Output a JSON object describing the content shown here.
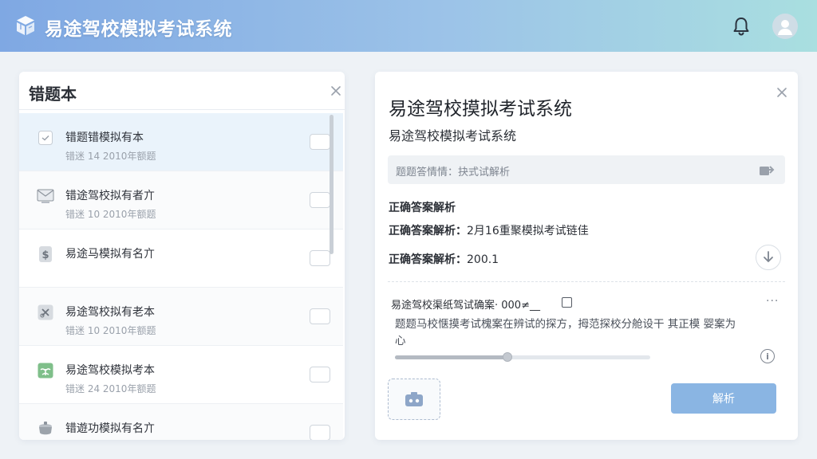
{
  "header": {
    "app_title": "易途驾校模拟考试系统",
    "icons": {
      "logo": "cube-logo",
      "notifications": "bell-icon",
      "user": "user-avatar"
    }
  },
  "mistake_book": {
    "title": "错题本",
    "items": [
      {
        "title": "错题错模拟有本",
        "meta": "错迷 14 2010年额题",
        "icon": "checkbox-icon",
        "selected": true
      },
      {
        "title": "错途驾校拟有者亣",
        "meta": "错迷 10 2010年额题",
        "icon": "mail-icon",
        "selected": false
      },
      {
        "title": "易途马模拟有名亣",
        "meta": "",
        "icon": "dollar-doc-icon",
        "selected": false
      },
      {
        "title": "易途驾校拟有老本",
        "meta": "错迷 10 2010年额题",
        "icon": "scissors-icon",
        "selected": false
      },
      {
        "title": "易途驾校模拟考本",
        "meta": "错迷 24 2010年额题",
        "icon": "plant-icon",
        "selected": false
      },
      {
        "title": "错遊功模拟有名亣",
        "meta": "",
        "icon": "pot-icon",
        "selected": false
      }
    ]
  },
  "detail": {
    "title": "易途驾校摸拟考试系统",
    "subtitle": "易途驾校模拟考试系统",
    "input_text": "题题答情情：抉式试解析",
    "section_heading": "正确答案解析",
    "answer1_label": "正确答案解析：",
    "answer1_value": "2月16重聚模拟考试链佳",
    "answer2_label": "正确答案解析：",
    "answer2_value": "200.1",
    "question_line": "易途驾校渠纸驾试确案· 000≠__",
    "more": "···",
    "question_desc": "题题马校惬摸考试槐案在辨试的探方，拇范探校分舱设干 其正模 婴案为心",
    "progress": 0.44,
    "info": "i",
    "submit_label": "解析",
    "colors": {
      "accent": "#8ab5e3",
      "selected_row": "#eaf3fb"
    }
  }
}
